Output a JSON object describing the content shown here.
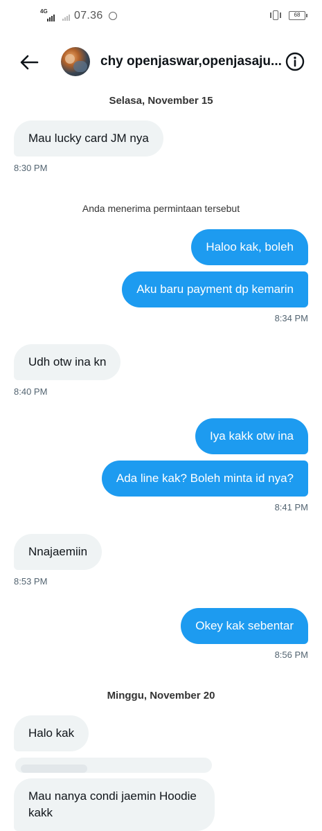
{
  "status_bar": {
    "network": "4G",
    "time": "07.36",
    "battery": "68"
  },
  "header": {
    "title": "chy openjaswar,openjasaju..."
  },
  "dates": {
    "first": "Selasa, November 15",
    "second": "Minggu, November 20"
  },
  "system_note": "Anda menerima permintaan tersebut",
  "messages": [
    {
      "text": "Mau lucky card JM nya",
      "from": "them"
    },
    {
      "text": "Haloo kak, boleh",
      "from": "me"
    },
    {
      "text": "Aku baru payment dp kemarin",
      "from": "me"
    },
    {
      "text": "Udh otw ina kn",
      "from": "them"
    },
    {
      "text": "Iya kakk otw ina",
      "from": "me"
    },
    {
      "text": "Ada line kak? Boleh minta id nya?",
      "from": "me"
    },
    {
      "text": "Nnajaemiin",
      "from": "them"
    },
    {
      "text": "Okey kak sebentar",
      "from": "me"
    },
    {
      "text": "Halo kak",
      "from": "them"
    },
    {
      "text": "Mau nanya condi jaemin Hoodie kakk",
      "from": "them"
    }
  ],
  "timestamps": [
    "8:30 PM",
    "8:34 PM",
    "8:40 PM",
    "8:41 PM",
    "8:53 PM",
    "8:56 PM"
  ],
  "colors": {
    "outgoing_bubble": "#1d9bf0",
    "incoming_bubble": "#eff3f4",
    "timestamp": "#536471"
  },
  "icons": {
    "back": "arrow-left-icon",
    "info": "info-icon"
  }
}
